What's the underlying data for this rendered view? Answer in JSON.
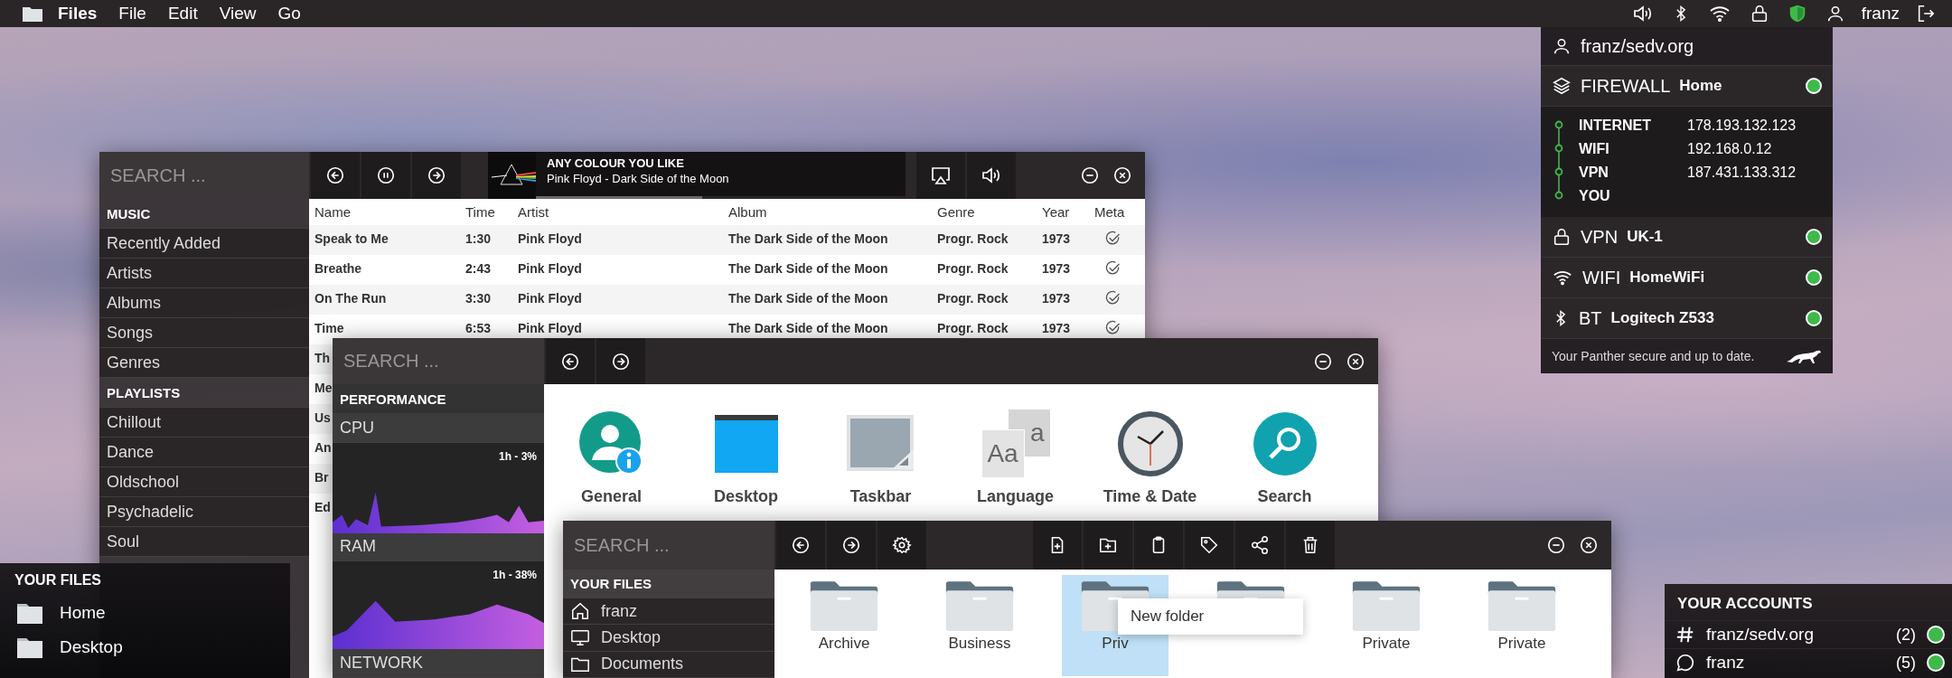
{
  "top_bar": {
    "app_name": "Files",
    "menus": [
      "File",
      "Edit",
      "View",
      "Go"
    ],
    "user": "franz"
  },
  "music_window": {
    "search": {
      "placeholder": "SEARCH ..."
    },
    "sidebar": [
      {
        "kind": "header",
        "label": "MUSIC"
      },
      {
        "kind": "item",
        "label": "Recently Added"
      },
      {
        "kind": "item",
        "label": "Artists"
      },
      {
        "kind": "item",
        "label": "Albums"
      },
      {
        "kind": "item",
        "label": "Songs"
      },
      {
        "kind": "item",
        "label": "Genres"
      },
      {
        "kind": "header",
        "label": "PLAYLISTS"
      },
      {
        "kind": "item",
        "label": "Chillout"
      },
      {
        "kind": "item",
        "label": "Dance"
      },
      {
        "kind": "item",
        "label": "Oldschool"
      },
      {
        "kind": "item",
        "label": "Psychadelic"
      },
      {
        "kind": "item",
        "label": "Soul"
      }
    ],
    "now_playing": {
      "title": "ANY COLOUR YOU LIKE",
      "subtitle": "Pink Floyd - Dark Side of the Moon",
      "level": 0.45
    },
    "table": {
      "columns": [
        "Name",
        "Time",
        "Artist",
        "Album",
        "Genre",
        "Year",
        "Meta"
      ],
      "rows": [
        {
          "name": "Speak to Me",
          "time": "1:30",
          "artist": "Pink Floyd",
          "album": "The Dark Side of the Moon",
          "genre": "Progr. Rock",
          "year": "1973",
          "meta": true
        },
        {
          "name": "Breathe",
          "time": "2:43",
          "artist": "Pink Floyd",
          "album": "The Dark Side of the Moon",
          "genre": "Progr. Rock",
          "year": "1973",
          "meta": true
        },
        {
          "name": "On The Run",
          "time": "3:30",
          "artist": "Pink Floyd",
          "album": "The Dark Side of the Moon",
          "genre": "Progr. Rock",
          "year": "1973",
          "meta": true
        },
        {
          "name": "Time",
          "time": "6:53",
          "artist": "Pink Floyd",
          "album": "The Dark Side of the Moon",
          "genre": "Progr. Rock",
          "year": "1973",
          "meta": true
        },
        {
          "name": "Th"
        },
        {
          "name": "Me"
        },
        {
          "name": "Us"
        },
        {
          "name": "An"
        },
        {
          "name": "Br"
        },
        {
          "name": "Ed"
        }
      ]
    }
  },
  "settings_window": {
    "search": {
      "placeholder": "SEARCH ..."
    },
    "sidebar": {
      "header": "PERFORMANCE",
      "monitors": [
        {
          "label": "CPU",
          "reading": "1h - 3%"
        },
        {
          "label": "RAM",
          "reading": "1h - 38%"
        },
        {
          "label": "NETWORK"
        }
      ]
    },
    "categories": [
      {
        "kind": "general",
        "label": "General"
      },
      {
        "kind": "desktop",
        "label": "Desktop"
      },
      {
        "kind": "taskbar",
        "label": "Taskbar"
      },
      {
        "kind": "language",
        "label": "Language",
        "glyphs": [
          "a",
          "Aa"
        ]
      },
      {
        "kind": "time",
        "label": "Time & Date"
      },
      {
        "kind": "search",
        "label": "Search"
      }
    ]
  },
  "files_window": {
    "search": {
      "placeholder": "SEARCH ..."
    },
    "sidebar": {
      "header": "YOUR FILES",
      "items": [
        {
          "kind": "home",
          "label": "franz"
        },
        {
          "kind": "desktop",
          "label": "Desktop"
        },
        {
          "kind": "folder",
          "label": "Documents"
        }
      ]
    },
    "folders": [
      {
        "label": "Archive",
        "selected": false
      },
      {
        "label": "Business",
        "selected": false
      },
      {
        "label": "Priv",
        "selected": true
      },
      {
        "selected": false
      },
      {
        "label": "Private",
        "selected": false
      },
      {
        "label": "Private",
        "selected": false
      }
    ],
    "context_menu": [
      "New folder"
    ]
  },
  "network_panel": {
    "account": "franz/sedv.org",
    "firewall": {
      "label": "FIREWALL",
      "value": "Home",
      "online": true
    },
    "route": [
      {
        "label": "INTERNET",
        "address": "178.193.132.123"
      },
      {
        "label": "WIFI",
        "address": "192.168.0.12"
      },
      {
        "label": "VPN",
        "address": "187.431.133.312"
      },
      {
        "label": "YOU"
      }
    ],
    "connections": [
      {
        "kind": "vpn",
        "label": "VPN",
        "value": "UK-1",
        "online": true
      },
      {
        "kind": "wifi",
        "label": "WIFI",
        "value": "HomeWiFi",
        "online": true
      },
      {
        "kind": "bluetooth",
        "label": "BT",
        "value": "Logitech Z533",
        "online": true
      }
    ],
    "footer": "Your Panther secure and up to date."
  },
  "files_panel": {
    "header": "YOUR FILES",
    "items": [
      "Home",
      "Desktop"
    ]
  },
  "accounts_panel": {
    "header": "YOUR ACCOUNTS",
    "items": [
      {
        "kind": "hash",
        "label": "franz/sedv.org",
        "count": "(2)",
        "online": true
      },
      {
        "kind": "chat",
        "label": "franz",
        "count": "(5)",
        "online": true
      }
    ]
  }
}
